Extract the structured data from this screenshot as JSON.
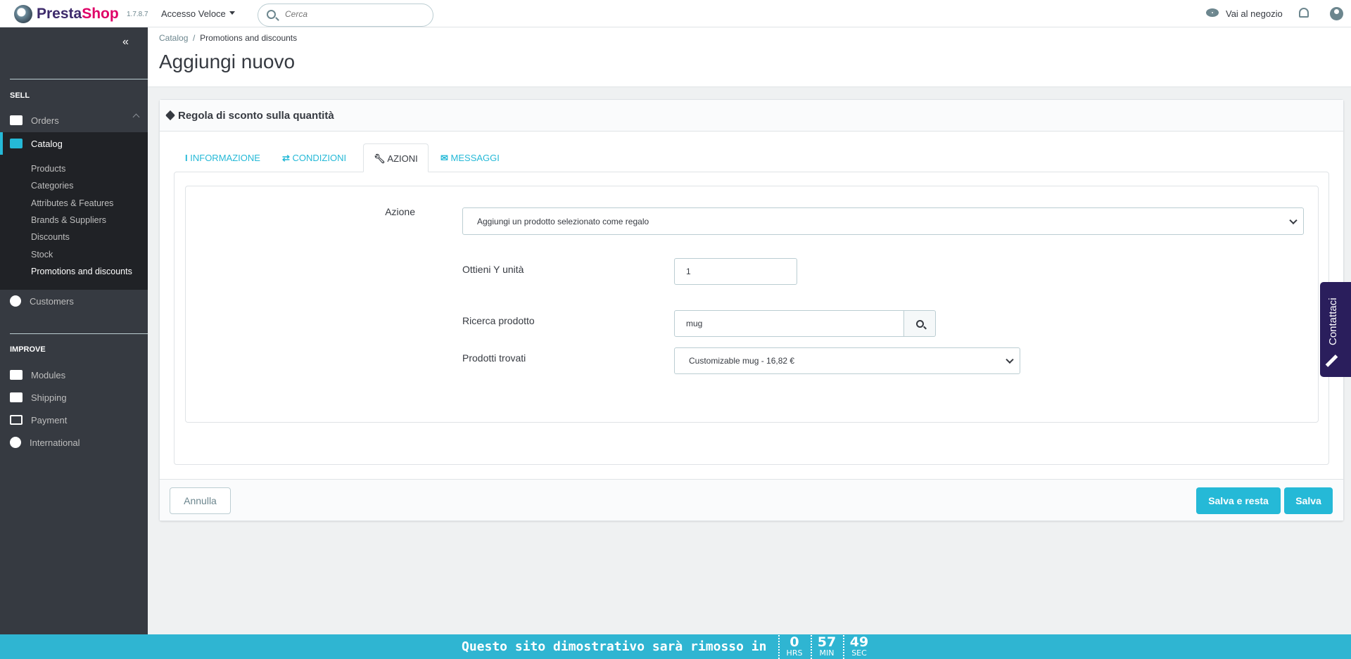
{
  "header": {
    "brand_a": "Presta",
    "brand_b": "Shop",
    "version": "1.7.8.7",
    "quick_access": "Accesso Veloce",
    "search_placeholder": "Cerca",
    "view_shop": "Vai al negozio"
  },
  "sidebar": {
    "collapse": "«",
    "sell": "SELL",
    "improve": "IMPROVE",
    "items": [
      {
        "label": "Orders"
      },
      {
        "label": "Catalog"
      },
      {
        "label": "Customers"
      },
      {
        "label": "Modules"
      },
      {
        "label": "Shipping"
      },
      {
        "label": "Payment"
      },
      {
        "label": "International"
      }
    ],
    "catalog_sub": [
      "Products",
      "Categories",
      "Attributes & Features",
      "Brands & Suppliers",
      "Discounts",
      "Stock",
      "Promotions and discounts"
    ]
  },
  "breadcrumb": {
    "parent": "Catalog",
    "sep": "/",
    "current": "Promotions and discounts"
  },
  "page_title": "Aggiungi nuovo",
  "panel": {
    "title": "Regola di sconto sulla quantità",
    "tabs": [
      {
        "label": "Informazione"
      },
      {
        "label": "Condizioni"
      },
      {
        "label": "Azioni"
      },
      {
        "label": "Messaggi"
      }
    ],
    "form": {
      "action_label": "Azione",
      "action_value": "Aggiungi un prodotto selezionato come regalo",
      "qty_label": "Ottieni Y unità",
      "qty_value": "1",
      "search_label": "Ricerca prodotto",
      "search_value": "mug",
      "found_label": "Prodotti trovati",
      "found_value": "Customizable mug - 16,82 €"
    },
    "cancel": "Annulla",
    "save_stay": "Salva e resta",
    "save": "Salva"
  },
  "contact": "Contattaci",
  "banner": {
    "message": "Questo sito dimostrativo sarà rimosso in",
    "hours": "0",
    "hours_unit": "HRS",
    "minutes": "57",
    "minutes_unit": "MIN",
    "seconds": "49",
    "seconds_unit": "SEC"
  },
  "colors": {
    "accent": "#25b9d7",
    "sidebar": "#363a41",
    "banner": "#2fb5d2",
    "contact": "#2a1e5c"
  }
}
